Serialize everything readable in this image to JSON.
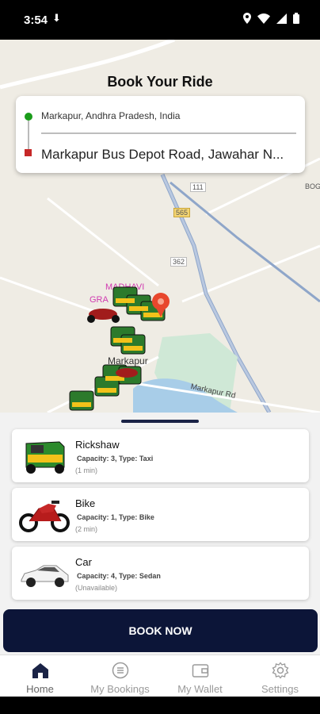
{
  "status_bar": {
    "time": "3:54",
    "download_glyph": "⬇"
  },
  "map": {
    "labels": {
      "madhavi": "MADHAVI",
      "gra": "GRA",
      "markapur": "Markapur",
      "markapur_road": "Markapur Rd",
      "route_111": "111",
      "route_565": "565",
      "route_362": "362",
      "bog": "BOG"
    },
    "marker_color": "#e8472d"
  },
  "header": {
    "title": "Book Your Ride"
  },
  "route": {
    "from": "Markapur, Andhra Pradesh, India",
    "to": "Markapur Bus Depot Road, Jawahar N..."
  },
  "vehicles": [
    {
      "name": "Rickshaw",
      "details": "Capacity: 3, Type: Taxi",
      "eta": "(1 min)",
      "icon": "rickshaw-image"
    },
    {
      "name": "Bike",
      "details": "Capacity: 1, Type: Bike",
      "eta": "(2 min)",
      "icon": "motorbike-image"
    },
    {
      "name": "Car",
      "details": "Capacity: 4, Type: Sedan",
      "eta": "(Unavailable)",
      "icon": "car-image"
    }
  ],
  "book_button": {
    "label": "BOOK NOW"
  },
  "bottom_nav": [
    {
      "label": "Home",
      "icon": "home-icon",
      "active": true
    },
    {
      "label": "My Bookings",
      "icon": "list-icon",
      "active": false
    },
    {
      "label": "My Wallet",
      "icon": "wallet-icon",
      "active": false
    },
    {
      "label": "Settings",
      "icon": "gear-icon",
      "active": false
    }
  ],
  "colors": {
    "primary": "#0c1538",
    "green": "#1a9c1a",
    "red": "#c62828"
  }
}
